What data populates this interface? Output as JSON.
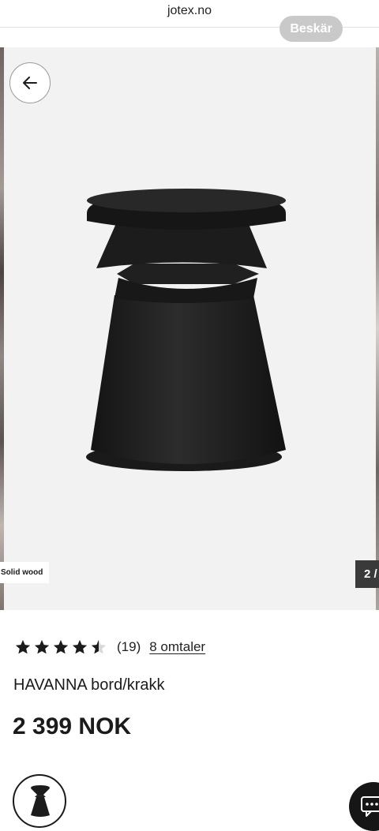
{
  "browser": {
    "url": "jotex.no",
    "crop_button": "Beskär"
  },
  "gallery": {
    "badge": "Solid wood",
    "counter": "2 /",
    "back_icon": "arrow-left-icon"
  },
  "product": {
    "rating": 4.5,
    "rating_count": "(19)",
    "reviews_link": "8 omtaler",
    "name": "HAVANNA bord/krakk",
    "price": "2 399 NOK"
  },
  "colors": {
    "star": "#1b1b1b",
    "chat_bg": "#161616"
  },
  "icons": {
    "chat": "chat-bubble-icon",
    "star": "star-icon"
  }
}
